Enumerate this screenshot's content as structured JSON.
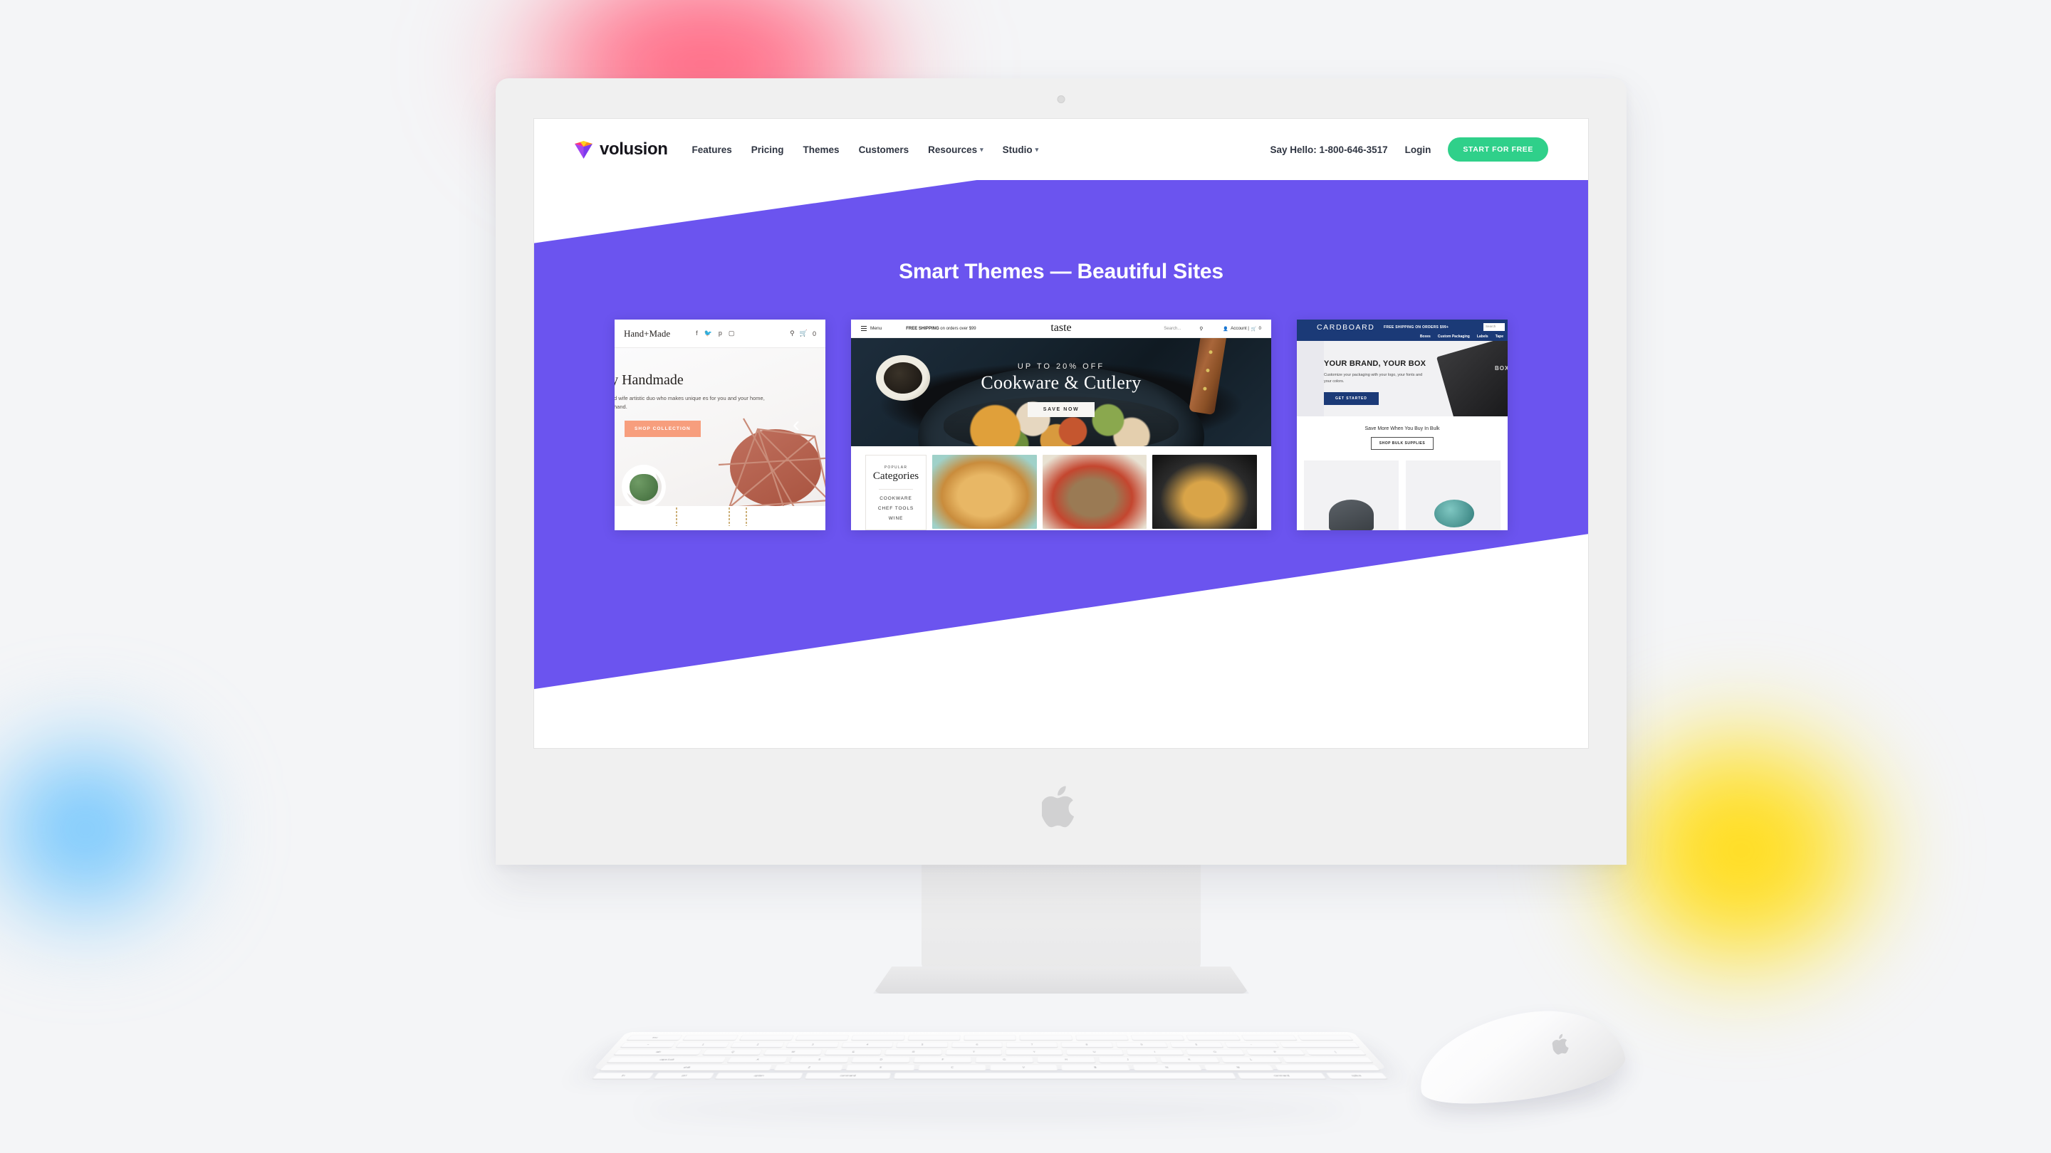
{
  "colors": {
    "purple": "#6b54ef",
    "green_cta": "#2fd08a",
    "salmon": "#f79e7d",
    "navy": "#1b3a77",
    "page_bg": "#f4f5f7",
    "blob_pink": "#ff5d7a",
    "blob_blue": "#63b9fb",
    "blob_yellow": "#ffd814"
  },
  "site": {
    "nav": {
      "logo_text": "volusion",
      "logo_icon": "gem-icon",
      "links": [
        {
          "label": "Features",
          "has_caret": false
        },
        {
          "label": "Pricing",
          "has_caret": false
        },
        {
          "label": "Themes",
          "has_caret": false
        },
        {
          "label": "Customers",
          "has_caret": false
        },
        {
          "label": "Resources",
          "has_caret": true
        },
        {
          "label": "Studio",
          "has_caret": true
        }
      ],
      "say_hello": "Say Hello:  1-800-646-3517",
      "login": "Login",
      "cta": "START FOR FREE"
    },
    "hero": {
      "title": "Smart Themes — Beautiful Sites"
    },
    "carousel": {
      "prev_icon": "chevron-left-icon",
      "next_icon": "chevron-right-icon",
      "prev_label": "‹",
      "next_label": "›"
    }
  },
  "slide_handmade": {
    "logo": "Hand+Made",
    "social": [
      "f",
      "t",
      "p",
      "ig"
    ],
    "search_icon": "search-icon",
    "cart_icon": "cart-icon",
    "cart_count": "0",
    "headline": "ingly Handmade",
    "subtext": "usband and wife artistic duo who makes unique es for you and your home, always by hand.",
    "button": "SHOP COLLECTION"
  },
  "slide_taste": {
    "menu": "Menu",
    "shipping_bold": "FREE SHIPPING",
    "shipping_rest": " on orders over $99",
    "logo": "taste",
    "search_placeholder": "Search...",
    "account": "Account |",
    "cart_count": "0",
    "kicker": "UP TO 20% OFF",
    "headline": "Cookware & Cutlery",
    "button": "SAVE NOW",
    "categories_kicker": "POPULAR",
    "categories_title": "Categories",
    "categories": [
      "COOKWARE",
      "CHEF TOOLS",
      "WINE"
    ]
  },
  "slide_cardboard": {
    "logo": "CARDBOARD",
    "shipping": "FREE SHIPPING ON ORDERS $99+",
    "search_placeholder": "Search",
    "nav": [
      "Boxes",
      "Custom Packaging",
      "Labels",
      "Tape"
    ],
    "headline": "YOUR BRAND, YOUR BOX",
    "subtext": "Customize your packaging with your logo, your fonts and your colors.",
    "button": "GET STARTED",
    "box_label": "BOX",
    "bulk_title": "Save More When You Buy In Bulk",
    "bulk_button": "SHOP BULK SUPPLIES"
  },
  "hardware": {
    "apple_logo": "apple-logo-icon",
    "keyboard_rows": [
      [
        "esc",
        "",
        "",
        "",
        "",
        "",
        "",
        "",
        "",
        "",
        "",
        "",
        ""
      ],
      [
        "~",
        "1",
        "2",
        "3",
        "4",
        "5",
        "6",
        "7",
        "8",
        "9",
        "0",
        "-",
        "="
      ],
      [
        "tab",
        "Q",
        "W",
        "E",
        "R",
        "T",
        "Y",
        "U",
        "I",
        "O",
        "P",
        "[",
        "]"
      ],
      [
        "caps lock",
        "A",
        "S",
        "D",
        "F",
        "G",
        "H",
        "J",
        "K",
        "L",
        ";",
        "'"
      ],
      [
        "shift",
        "Z",
        "X",
        "C",
        "V",
        "B",
        "N",
        "M",
        ",",
        ".",
        "/"
      ],
      [
        "fn",
        "ctrl",
        "option",
        "command",
        "",
        "command",
        "option"
      ]
    ]
  }
}
